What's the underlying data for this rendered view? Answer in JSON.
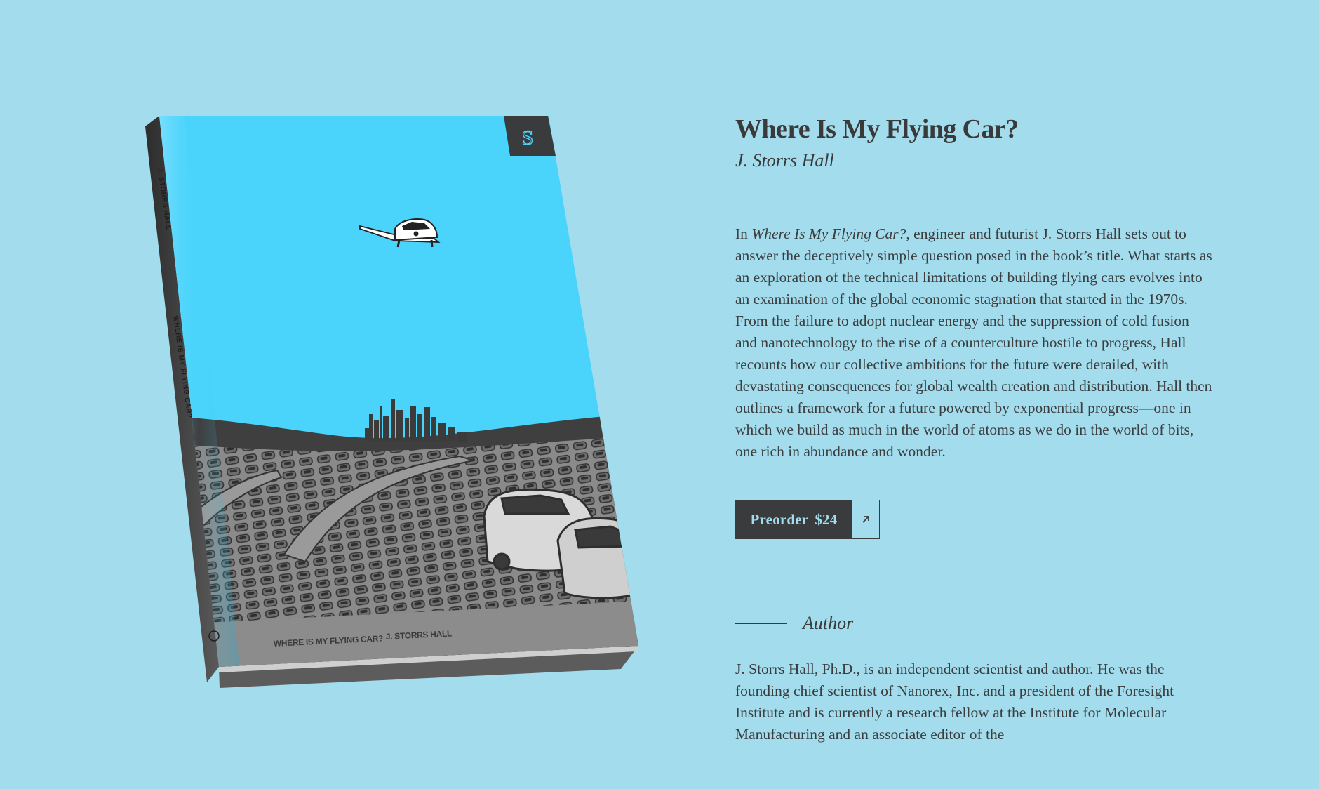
{
  "book": {
    "title": "Where Is My Flying Car?",
    "author": "J. Storrs Hall",
    "cover": {
      "title": "WHERE IS MY FLYING CAR?",
      "author": "J. STORRS HALL",
      "spine_title": "WHERE IS MY FLYING CAR?",
      "spine_author": "J. STORRS HALL",
      "publisher_mark": "S",
      "sky_color": "#4ad4fb"
    }
  },
  "description": {
    "intro": "In ",
    "title_italic": "Where Is My Flying Car?",
    "body": ", engineer and futurist J. Storrs Hall sets out to answer the deceptively simple question posed in the book’s title. What starts as an exploration of the technical limitations of building flying cars evolves into an examination of the global economic stagnation that started in the 1970s. From the failure to adopt nuclear energy and the suppression of cold fusion and nanotechnology to the rise of a counterculture hostile to progress, Hall recounts how our collective ambitions for the future were derailed, with devastating consequences for global wealth creation and distribution. Hall then outlines a framework for a future powered by exponential progress—one in which we build as much in the world of atoms as we do in the world of bits, one rich in abundance and wonder."
  },
  "preorder": {
    "label": "Preorder",
    "price": "$24",
    "icon": "external-link-arrow-icon"
  },
  "author_section": {
    "heading": "Author",
    "bio": "J. Storrs Hall, Ph.D., is an independent scientist and author. He was the founding chief scientist of Nanorex, Inc. and a president of the Foresight Institute and is currently a research fellow at the Institute for Molecular Manufacturing and an associate editor of the"
  },
  "colors": {
    "background": "#a2dced",
    "text": "#3b3d3e",
    "button_bg": "#3a3b3c",
    "button_text": "#a2dced"
  }
}
